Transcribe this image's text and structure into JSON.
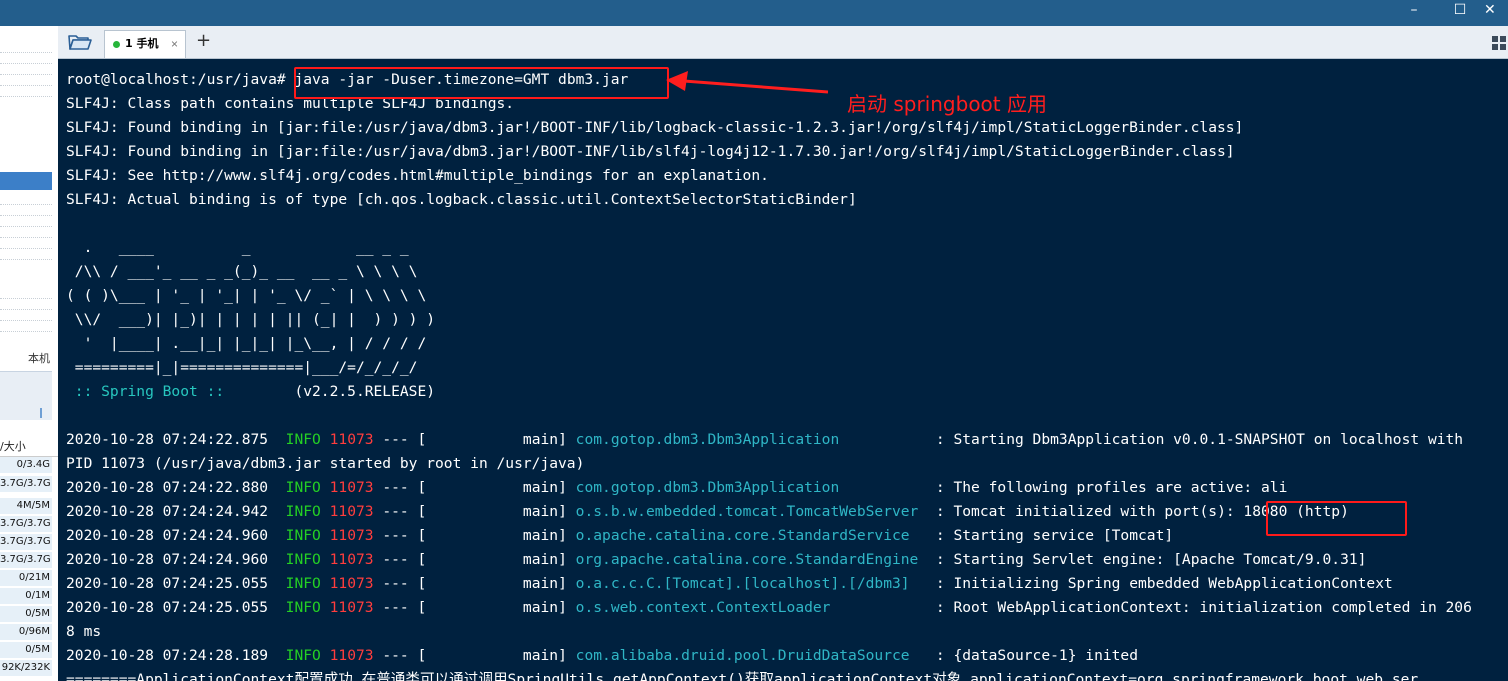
{
  "window": {
    "minimize": "–",
    "maximize": "☐",
    "close": "✕"
  },
  "sidebar": {
    "local_label": "本机",
    "size_header": "/大小",
    "rows": [
      "0/3.4G",
      "3.7G/3.7G",
      "4M/5M",
      "3.7G/3.7G",
      "3.7G/3.7G",
      "3.7G/3.7G",
      "0/21M",
      "0/1M",
      "0/5M",
      "0/96M",
      "0/5M",
      "92K/232K"
    ]
  },
  "tabs": [
    {
      "label": "1 手机",
      "close": "×",
      "status_color": "#27b53a"
    }
  ],
  "add_tab_label": "+",
  "terminal": {
    "prompt": "root@localhost:/usr/java#",
    "command": " java -jar -Duser.timezone=GMT dbm3.jar",
    "slf4j": [
      "SLF4J: Class path contains multiple SLF4J bindings.",
      "SLF4J: Found binding in [jar:file:/usr/java/dbm3.jar!/BOOT-INF/lib/logback-classic-1.2.3.jar!/org/slf4j/impl/StaticLoggerBinder.class]",
      "SLF4J: Found binding in [jar:file:/usr/java/dbm3.jar!/BOOT-INF/lib/slf4j-log4j12-1.7.30.jar!/org/slf4j/impl/StaticLoggerBinder.class]",
      "SLF4J: See http://www.slf4j.org/codes.html#multiple_bindings for an explanation.",
      "SLF4J: Actual binding is of type [ch.qos.logback.classic.util.ContextSelectorStaticBinder]"
    ],
    "banner": [
      "  .   ____          _            __ _ _",
      " /\\\\ / ___'_ __ _ _(_)_ __  __ _ \\ \\ \\ \\",
      "( ( )\\___ | '_ | '_| | '_ \\/ _` | \\ \\ \\ \\",
      " \\\\/  ___)| |_)| | | | | || (_| |  ) ) ) )",
      "  '  |____| .__|_| |_|_| |_\\__, | / / / /",
      " =========|_|==============|___/=/_/_/_/"
    ],
    "spring_boot_label": " :: Spring Boot :: ",
    "spring_boot_version": "       (v2.2.5.RELEASE)",
    "logs": [
      {
        "ts": "2020-10-28 07:24:22.875",
        "level": "INFO",
        "pid": "11073",
        "sep": " --- [",
        "thread": "           main]",
        "logger": "com.gotop.dbm3.Dbm3Application          ",
        "msg": "Starting Dbm3Application v0.0.1-SNAPSHOT on localhost with"
      },
      {
        "ts": "2020-10-28 07:24:22.880",
        "level": "INFO",
        "pid": "11073",
        "sep": " --- [",
        "thread": "           main]",
        "logger": "com.gotop.dbm3.Dbm3Application          ",
        "msg": "The following profiles are active: ali"
      },
      {
        "ts": "2020-10-28 07:24:24.942",
        "level": "INFO",
        "pid": "11073",
        "sep": " --- [",
        "thread": "           main]",
        "logger": "o.s.b.w.embedded.tomcat.TomcatWebServer ",
        "msg": "Tomcat initialized with port(s): 18080 (http)"
      },
      {
        "ts": "2020-10-28 07:24:24.960",
        "level": "INFO",
        "pid": "11073",
        "sep": " --- [",
        "thread": "           main]",
        "logger": "o.apache.catalina.core.StandardService  ",
        "msg": "Starting service [Tomcat]"
      },
      {
        "ts": "2020-10-28 07:24:24.960",
        "level": "INFO",
        "pid": "11073",
        "sep": " --- [",
        "thread": "           main]",
        "logger": "org.apache.catalina.core.StandardEngine ",
        "msg": "Starting Servlet engine: [Apache Tomcat/9.0.31]"
      },
      {
        "ts": "2020-10-28 07:24:25.055",
        "level": "INFO",
        "pid": "11073",
        "sep": " --- [",
        "thread": "           main]",
        "logger": "o.a.c.c.C.[Tomcat].[localhost].[/dbm3]  ",
        "msg": "Initializing Spring embedded WebApplicationContext"
      },
      {
        "ts": "2020-10-28 07:24:25.055",
        "level": "INFO",
        "pid": "11073",
        "sep": " --- [",
        "thread": "           main]",
        "logger": "o.s.web.context.ContextLoader           ",
        "msg": "Root WebApplicationContext: initialization completed in 206"
      },
      {
        "ts": "2020-10-28 07:24:28.189",
        "level": "INFO",
        "pid": "11073",
        "sep": " --- [",
        "thread": "           main]",
        "logger": "com.alibaba.druid.pool.DruidDataSource  ",
        "msg": "{dataSource-1} inited"
      }
    ],
    "wrap_pid": "PID 11073 (/usr/java/dbm3.jar started by root in /usr/java)",
    "wrap_ms": "8 ms",
    "last_line": "========ApplicationContext配置成功,在普通类可以通过调用SpringUtils.getAppContext()获取applicationContext对象,applicationContext=org.springframework.boot.web.ser"
  },
  "annotation": {
    "label": "启动 springboot  应用",
    "color": "#ff1e1e"
  },
  "colors": {
    "terminal_bg": "#00213f",
    "title_bar": "#235e8c",
    "info_green": "#24d024",
    "pid_red": "#ff3d3d",
    "logger_cyan": "#2fb6c6"
  }
}
